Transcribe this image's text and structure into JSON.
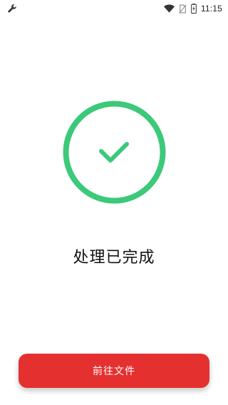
{
  "status_bar": {
    "time": "11:15",
    "left_icon": "wrench-icon",
    "right_icons": [
      "wifi-icon",
      "no-sim-icon",
      "battery-charging-icon"
    ]
  },
  "result": {
    "title": "处理已完成",
    "icon": "check-circle-icon",
    "accent_color": "#3cc97a"
  },
  "action": {
    "button_label": "前往文件",
    "button_color": "#e53030"
  }
}
